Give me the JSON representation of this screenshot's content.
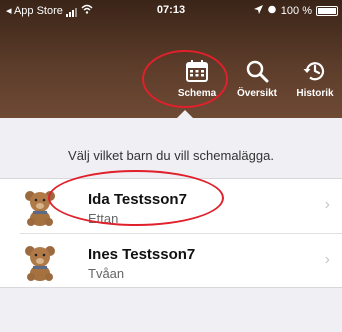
{
  "statusbar": {
    "back_label": "◂ App Store",
    "time": "07:13",
    "battery": "100 %"
  },
  "nav": {
    "schema": {
      "label": "Schema",
      "icon": "calendar-icon"
    },
    "oversikt": {
      "label": "Översikt",
      "icon": "search-icon"
    },
    "historik": {
      "label": "Historik",
      "icon": "history-icon"
    }
  },
  "instruction": "Välj vilket barn du vill schemalägga.",
  "children": [
    {
      "name": "Ida Testsson7",
      "group": "Ettan",
      "avatar": "teddy-bear-icon"
    },
    {
      "name": "Ines Testsson7",
      "group": "Tvåan",
      "avatar": "teddy-bear-icon"
    }
  ],
  "colors": {
    "header": "#4a2e20",
    "highlight": "#e0202a",
    "background": "#efeff4"
  }
}
